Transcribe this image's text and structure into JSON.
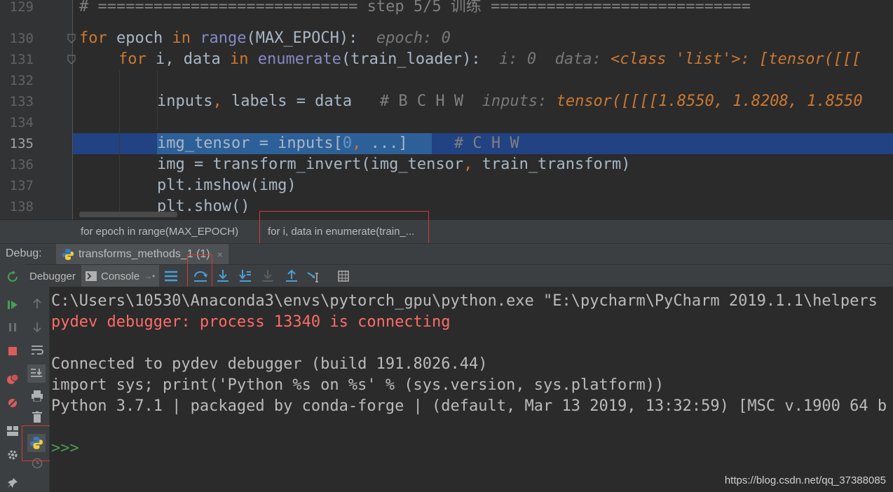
{
  "editor": {
    "lines": [
      {
        "num": "129"
      },
      {
        "num": "130"
      },
      {
        "num": "131"
      },
      {
        "num": "132"
      },
      {
        "num": "133"
      },
      {
        "num": "134"
      },
      {
        "num": "135"
      },
      {
        "num": "136"
      },
      {
        "num": "137"
      },
      {
        "num": "138"
      }
    ],
    "l129": "# ============================ step 5/5 训练 ============================",
    "l130": {
      "kw_for": "for",
      "v1": " epoch ",
      "kw_in": "in",
      "sp": " ",
      "bi_range": "range",
      "rest": "(MAX_EPOCH):",
      "inline": "  epoch: 0"
    },
    "l131": {
      "kw_for": "for",
      "v1": " i, data ",
      "kw_in": "in",
      "sp": " ",
      "bi_enum": "enumerate",
      "rest": "(train_loader):",
      "inline_i": "  i: 0",
      "inline_data_label": "  data: ",
      "inline_data_val": "<class 'list'>: [tensor([[["
    },
    "l133": {
      "code": "inputs",
      "comma": ",",
      "code2": " labels = data   ",
      "comment": "# B C H W",
      "inline_label": "  inputs: ",
      "inline_val": "tensor([[[[1.8550, 1.8208, 1.8550"
    },
    "l135": {
      "code": "img_tensor = inputs[",
      "num": "0",
      "comma": ", ",
      "rest": "...]",
      "comment": "     # C H W"
    },
    "l136": {
      "code": "img = transform_invert(img_tensor",
      "comma": ",",
      "rest": " train_transform)"
    },
    "l137": "plt.imshow(img)",
    "l138": "plt.show()"
  },
  "breadcrumb": {
    "items": [
      "for epoch in range(MAX_EPOCH)",
      "for i, data in enumerate(train_..."
    ]
  },
  "debug": {
    "label": "Debug:",
    "session_tab": "transforms_methods_1 (1)",
    "session_close": "×",
    "tabs": {
      "debugger": "Debugger",
      "console": "Console"
    }
  },
  "console": {
    "lines": [
      "C:\\Users\\10530\\Anaconda3\\envs\\pytorch_gpu\\python.exe \"E:\\pycharm\\PyCharm 2019.1.1\\helpers",
      "pydev debugger: process 13340 is connecting",
      "",
      "Connected to pydev debugger (build 191.8026.44)",
      "import sys; print('Python %s on %s' % (sys.version, sys.platform))",
      "Python 3.7.1 | packaged by conda-forge | (default, Mar 13 2019, 13:32:59) [MSC v.1900 64 b"
    ],
    "prompt": ">>>"
  },
  "watermark": "https://blog.csdn.net/qq_37388085",
  "colors": {
    "accent_red": "#d23a3a",
    "selection": "#214283",
    "keyword": "#cc7832",
    "builtin": "#8888c6"
  }
}
